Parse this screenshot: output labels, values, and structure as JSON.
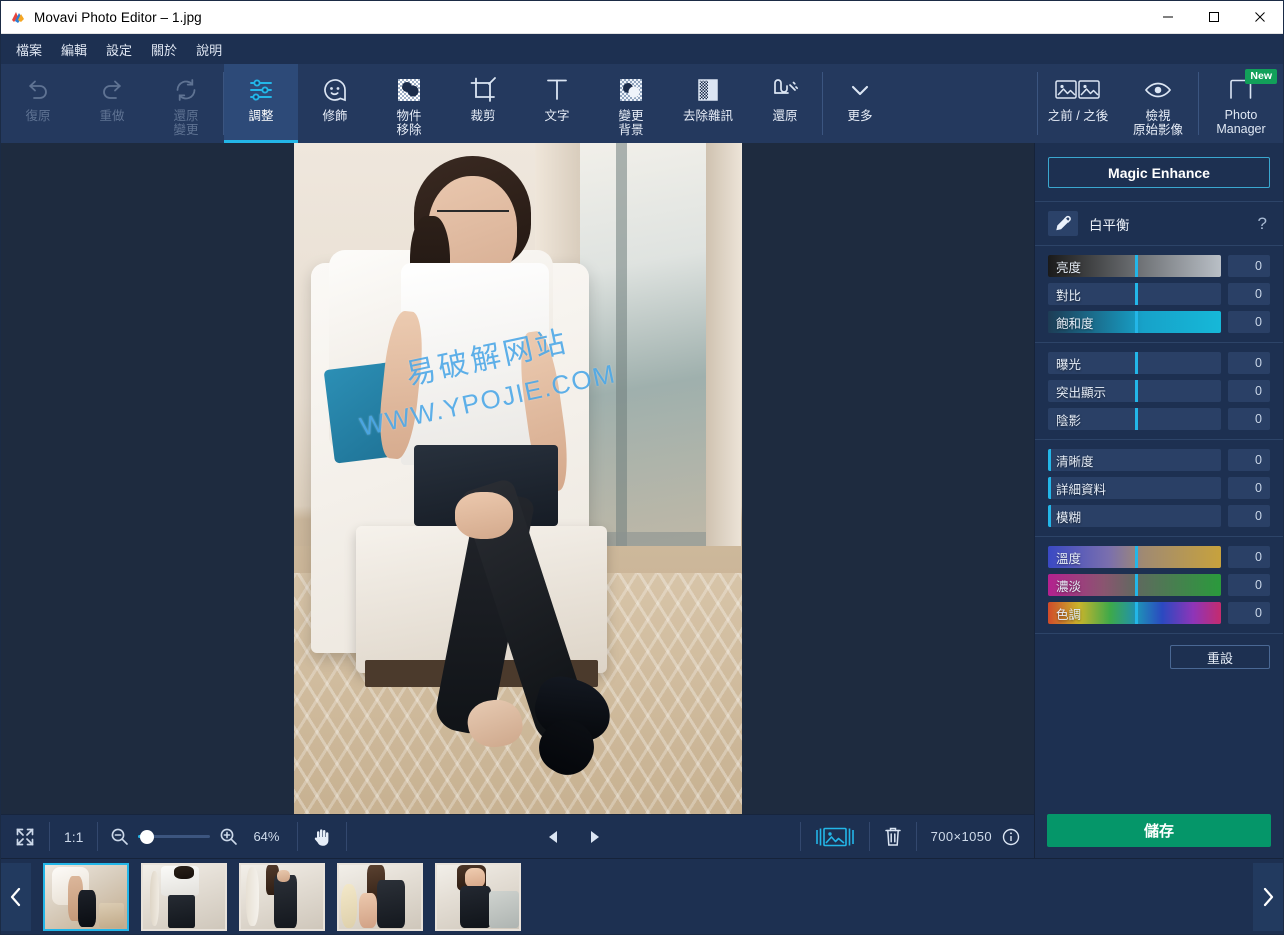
{
  "window": {
    "title": "Movavi Photo Editor – 1.jpg",
    "icon": "movavi-logo-icon",
    "controls": {
      "minimize": "–",
      "maximize": "□",
      "close": "✕"
    }
  },
  "menubar": {
    "items": [
      {
        "label": "檔案",
        "name": "menu-file"
      },
      {
        "label": "編輯",
        "name": "menu-edit"
      },
      {
        "label": "設定",
        "name": "menu-settings"
      },
      {
        "label": "關於",
        "name": "menu-about"
      },
      {
        "label": "說明",
        "name": "menu-help"
      }
    ]
  },
  "toolbar": {
    "history": [
      {
        "label": "復原",
        "icon": "undo-icon",
        "disabled": true
      },
      {
        "label": "重做",
        "icon": "redo-icon",
        "disabled": true
      },
      {
        "label": "還原\n變更",
        "icon": "revert-changes-icon",
        "disabled": true
      }
    ],
    "tools": [
      {
        "label": "調整",
        "icon": "adjust-sliders-icon",
        "active": true
      },
      {
        "label": "修飾",
        "icon": "retouch-face-icon",
        "active": false
      },
      {
        "label": "物件\n移除",
        "icon": "object-removal-icon",
        "active": false
      },
      {
        "label": "裁剪",
        "icon": "crop-icon",
        "active": false
      },
      {
        "label": "文字",
        "icon": "text-icon",
        "active": false
      },
      {
        "label": "變更\n背景",
        "icon": "change-background-icon",
        "active": false
      },
      {
        "label": "去除雜訊",
        "icon": "noise-removal-icon",
        "active": false
      },
      {
        "label": "還原",
        "icon": "restore-magic-icon",
        "active": false
      }
    ],
    "more": {
      "label": "更多",
      "icon": "chevron-down-icon"
    },
    "right": [
      {
        "label": "之前 / 之後",
        "icon": "before-after-icon"
      },
      {
        "label": "檢視\n原始影像",
        "icon": "eye-view-original-icon"
      }
    ],
    "photo_manager": {
      "label": "Photo\nManager",
      "badge": "New",
      "icon": "photo-manager-icon"
    }
  },
  "canvas": {
    "watermark_line1": "易破解网站",
    "watermark_line2": "WWW.YPOJIE.COM"
  },
  "bottombar": {
    "fit_icon": "fit-to-screen-icon",
    "actual_size": "1:1",
    "zoom_out_icon": "zoom-out-icon",
    "zoom_in_icon": "zoom-in-icon",
    "zoom_percent": "64%",
    "zoom_slider_value": 8,
    "pan_icon": "hand-pan-icon",
    "prev_icon": "previous-image-icon",
    "next_icon": "next-image-icon",
    "compare_icon": "image-strip-icon",
    "delete_icon": "trash-icon",
    "dimensions": "700×1050",
    "info_icon": "info-icon"
  },
  "right_panel": {
    "magic_enhance": "Magic Enhance",
    "white_balance": {
      "label": "白平衡",
      "icon": "eyedropper-icon",
      "help": "?"
    },
    "groups": [
      {
        "name": "tone",
        "sliders": [
          {
            "label": "亮度",
            "value": "0",
            "handle_pct": 50,
            "gradient": "brightness"
          },
          {
            "label": "對比",
            "value": "0",
            "handle_pct": 50,
            "gradient": "none"
          },
          {
            "label": "飽和度",
            "value": "0",
            "handle_pct": 50,
            "gradient": "saturation"
          }
        ]
      },
      {
        "name": "light",
        "sliders": [
          {
            "label": "曝光",
            "value": "0",
            "handle_pct": 50,
            "gradient": "none"
          },
          {
            "label": "突出顯示",
            "value": "0",
            "handle_pct": 50,
            "gradient": "none"
          },
          {
            "label": "陰影",
            "value": "0",
            "handle_pct": 50,
            "gradient": "none"
          }
        ]
      },
      {
        "name": "detail",
        "sliders": [
          {
            "label": "清晰度",
            "value": "0",
            "handle_pct": 0,
            "gradient": "none"
          },
          {
            "label": "詳細資料",
            "value": "0",
            "handle_pct": 0,
            "gradient": "none"
          },
          {
            "label": "模糊",
            "value": "0",
            "handle_pct": 0,
            "gradient": "none"
          }
        ]
      },
      {
        "name": "color",
        "sliders": [
          {
            "label": "溫度",
            "value": "0",
            "handle_pct": 50,
            "gradient": "temperature"
          },
          {
            "label": "濃淡",
            "value": "0",
            "handle_pct": 50,
            "gradient": "tint"
          },
          {
            "label": "色調",
            "value": "0",
            "handle_pct": 50,
            "gradient": "hue"
          }
        ]
      }
    ],
    "reset": "重設",
    "save": "儲存"
  },
  "filmstrip": {
    "prev_icon": "chevron-left-icon",
    "next_icon": "chevron-right-icon",
    "thumbnails": [
      {
        "name": "thumbnail-1",
        "selected": true
      },
      {
        "name": "thumbnail-2",
        "selected": false
      },
      {
        "name": "thumbnail-3",
        "selected": false
      },
      {
        "name": "thumbnail-4",
        "selected": false
      },
      {
        "name": "thumbnail-5",
        "selected": false
      }
    ]
  },
  "colors": {
    "accent": "#23b6e8",
    "panel": "#1d3051",
    "toolbar": "#24395e",
    "canvas_bg": "#1e2b3f",
    "save_green": "#059669",
    "badge_green": "#12a05a"
  }
}
